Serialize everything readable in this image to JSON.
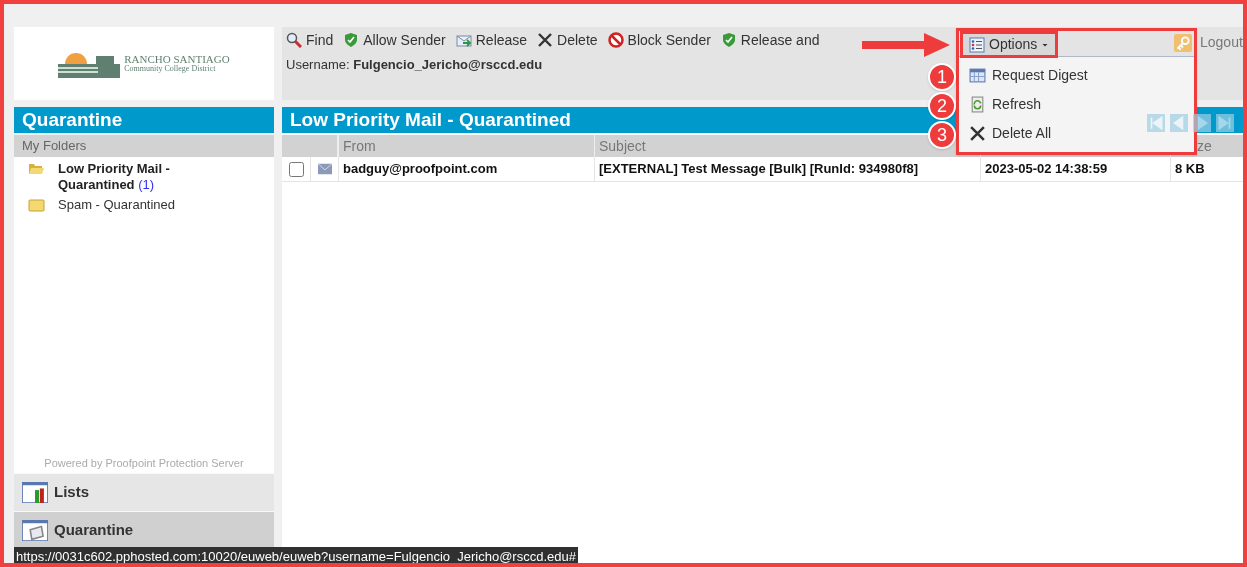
{
  "logo": {
    "name": "RANCHO SANTIAGO",
    "tagline": "Community College District"
  },
  "toolbar": [
    {
      "kind": "find",
      "label": "Find"
    },
    {
      "kind": "allow",
      "label": "Allow Sender"
    },
    {
      "kind": "release",
      "label": "Release"
    },
    {
      "kind": "delete",
      "label": "Delete"
    },
    {
      "kind": "block",
      "label": "Block Sender"
    },
    {
      "kind": "allow",
      "label": "Release and"
    }
  ],
  "options_button": {
    "label": "Options"
  },
  "logout": {
    "label": "Logout"
  },
  "username": {
    "label": "Username:",
    "value": "Fulgencio_Jericho@rsccd.edu"
  },
  "sidebar": {
    "title": "Quarantine",
    "section": "My Folders",
    "folders": [
      {
        "name": "Low Priority Mail - Quarantined",
        "count": "(1)",
        "selected": true
      },
      {
        "name": "Spam - Quarantined",
        "selected": false
      }
    ],
    "powered_by": "Powered by Proofpoint Protection Server",
    "nav": [
      {
        "kind": "lists",
        "label": "Lists",
        "selected": false
      },
      {
        "kind": "quarantine",
        "label": "Quarantine",
        "selected": true
      }
    ]
  },
  "content": {
    "title": "Low Priority Mail - Quarantined",
    "columns": [
      "From",
      "Subject",
      "",
      "ze"
    ],
    "rows": [
      {
        "checked": false,
        "from": "badguy@proofpoint.com",
        "subject": "[EXTERNAL] Test Message [Bulk] [RunId: 934980f8]",
        "date": "2023-05-02 14:38:59",
        "size": "8 KB"
      }
    ]
  },
  "options_menu": [
    {
      "kind": "digest",
      "label": "Request Digest",
      "step": "1"
    },
    {
      "kind": "refresh",
      "label": "Refresh",
      "step": "2"
    },
    {
      "kind": "delete",
      "label": "Delete All",
      "step": "3"
    }
  ],
  "status_url": "https://0031c602.pphosted.com:10020/euweb/euweb?username=Fulgencio_Jericho@rsccd.edu#"
}
